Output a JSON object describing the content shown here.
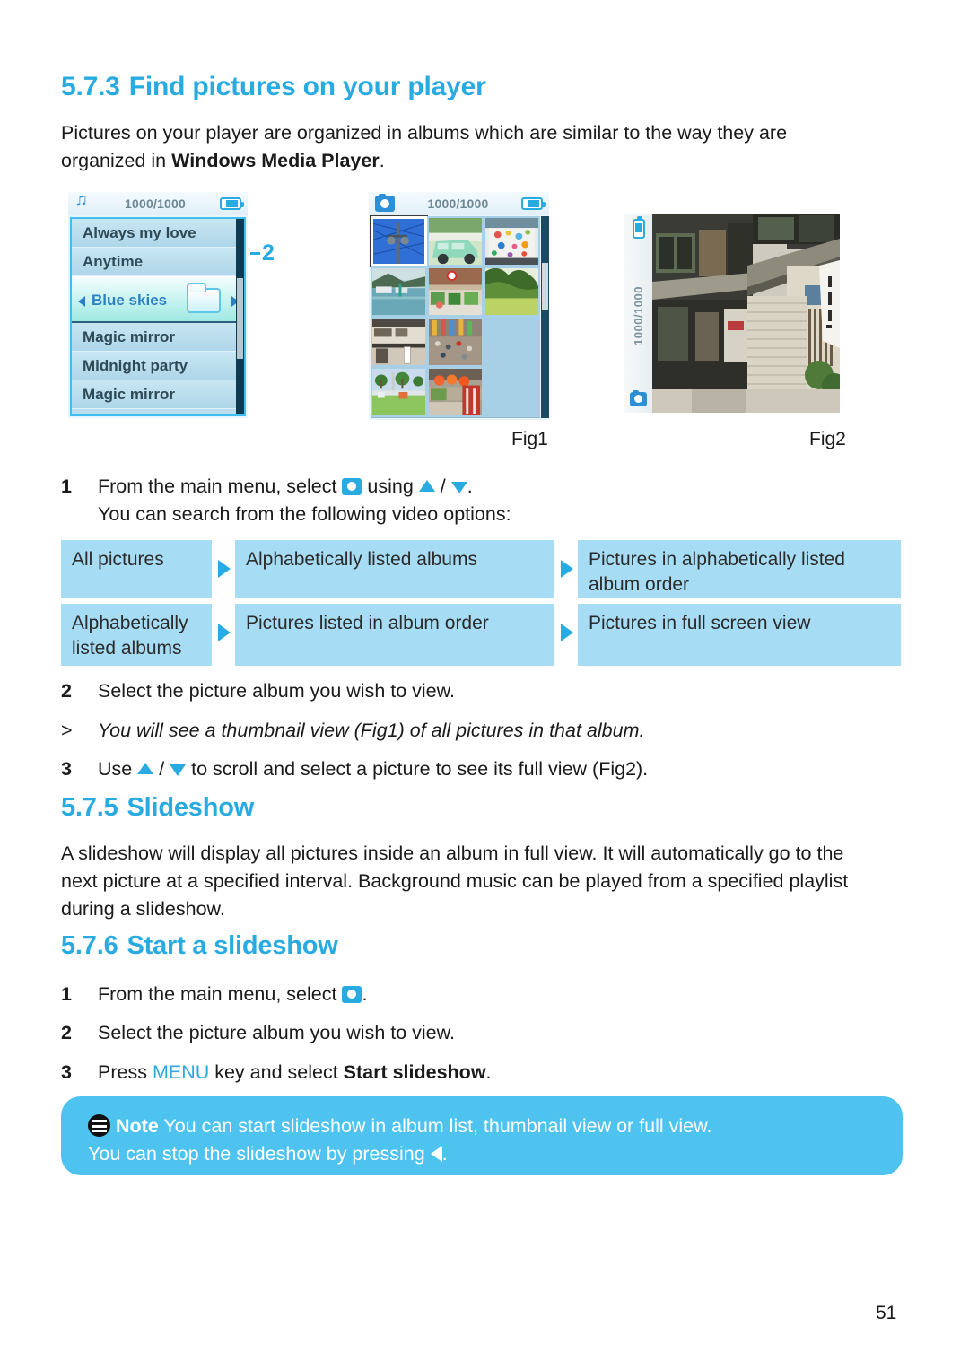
{
  "document": {
    "page_number": "51"
  },
  "sections": {
    "s573": {
      "number": "5.7.3",
      "title": "Find pictures on your player",
      "intro_line1": "Pictures on your player are organized in albums which are similar to the way they are",
      "intro_line2_pre": "organized in ",
      "intro_line2_bold": "Windows Media Player",
      "intro_line2_post": "."
    },
    "s575": {
      "number": "5.7.5",
      "title": "Slideshow",
      "body_line1": "A slideshow will display all pictures inside an album in full view. It will automatically go to the",
      "body_line2": "next picture at a specified interval. Background music can be played from a specified playlist",
      "body_line3": "during a slideshow."
    },
    "s576": {
      "number": "5.7.6",
      "title": "Start a slideshow"
    }
  },
  "figures": {
    "fig1_label": "Fig1",
    "fig2_label": "Fig2",
    "callout_2": "2",
    "album_screen": {
      "status_count": "1000/1000",
      "music_icon": "music-note-icon",
      "battery_icon": "battery-icon",
      "items": [
        {
          "label": "Always my love",
          "selected": false
        },
        {
          "label": "Anytime",
          "selected": false
        },
        {
          "label": "Blue skies",
          "selected": true
        },
        {
          "label": "Magic mirror",
          "selected": false
        },
        {
          "label": "Midnight party",
          "selected": false
        },
        {
          "label": "Magic mirror",
          "selected": false
        }
      ]
    },
    "thumbnail_screen": {
      "status_count": "1000/1000",
      "camera_icon": "camera-icon",
      "battery_icon": "battery-icon",
      "thumbnails": [
        {
          "selected": true,
          "empty": false,
          "alt": "utility pole against blue sky"
        },
        {
          "selected": false,
          "empty": false,
          "alt": "mint green minivan"
        },
        {
          "selected": false,
          "empty": false,
          "alt": "colourful painted bus"
        },
        {
          "selected": false,
          "empty": false,
          "alt": "harbour with boats and hills"
        },
        {
          "selected": false,
          "empty": false,
          "alt": "shopfront with plants"
        },
        {
          "selected": false,
          "empty": false,
          "alt": "green garden hillside"
        },
        {
          "selected": false,
          "empty": false,
          "alt": "old wooden house with banner"
        },
        {
          "selected": false,
          "empty": false,
          "alt": "crowded festival street"
        },
        {
          "selected": false,
          "empty": true,
          "alt": ""
        },
        {
          "selected": false,
          "empty": false,
          "alt": "park with trees and people"
        },
        {
          "selected": false,
          "empty": false,
          "alt": "red lanterns at a shop"
        },
        {
          "selected": false,
          "empty": true,
          "alt": ""
        }
      ]
    },
    "fullview_screen": {
      "status_count": "1000/1000",
      "battery_icon": "battery-icon",
      "camera_icon": "camera-icon",
      "alt": "traditional Japanese street with shuttered storefront"
    }
  },
  "steps_573": {
    "step1": {
      "num": "1",
      "pre": "From the main menu, select ",
      "icon": "camera-icon",
      "mid": " using ",
      "up": "up-triangle-icon",
      "sep": " / ",
      "down": "down-triangle-icon",
      "post": ".",
      "line2": "You can search from the following video options:"
    },
    "step2": {
      "num": "2",
      "text": "Select the picture album you wish to view."
    },
    "result": {
      "marker": ">",
      "text": "You will see a thumbnail view (Fig1) of all pictures in that album."
    },
    "step3": {
      "num": "3",
      "pre": "Use ",
      "up": "up-triangle-icon",
      "sep": " / ",
      "down": "down-triangle-icon",
      "post": " to scroll and select a picture to see its full view (Fig2)."
    }
  },
  "option_table": {
    "rows": [
      {
        "col1": "All pictures",
        "col2": "Alphabetically listed albums",
        "col3": "Pictures in alphabetically listed album order"
      },
      {
        "col1": "Alphabetically listed albums",
        "col2": "Pictures listed in album order",
        "col3": "Pictures in full screen view"
      }
    ],
    "arrow_icon": "right-triangle-icon"
  },
  "steps_576": {
    "step1": {
      "num": "1",
      "pre": "From the main menu, select ",
      "icon": "camera-icon",
      "post": "."
    },
    "step2": {
      "num": "2",
      "text": "Select the picture album you wish to view."
    },
    "step3": {
      "num": "3",
      "pre": "Press ",
      "keyword": "MENU",
      "mid": " key and select ",
      "bold": "Start slideshow",
      "post": "."
    }
  },
  "note": {
    "icon": "note-icon",
    "word": "Note",
    "line1": " You can start slideshow in album list, thumbnail view or full view.",
    "line2_pre": "You can stop the slideshow by pressing ",
    "left_icon": "left-triangle-icon",
    "line2_post": "."
  },
  "colors": {
    "accent_blue": "#29ABE2",
    "table_cell": "#A7DCF5",
    "note_box": "#4EC3F0",
    "text": "#1a1a1a"
  }
}
